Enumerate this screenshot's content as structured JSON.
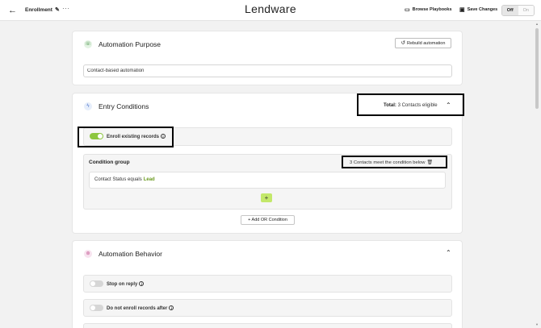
{
  "topbar": {
    "back_icon": "←",
    "workflow_name": "Enrollment",
    "edit_icon": "✎",
    "more_icon": "···",
    "brand": "Lendware",
    "browse_icon": "▭",
    "browse_label": "Browse Playbooks",
    "save_icon": "▣",
    "save_label": "Save Changes",
    "toggle_off": "Off",
    "toggle_on": "On"
  },
  "purpose": {
    "icon": "☏",
    "title": "Automation Purpose",
    "rebuild_icon": "↺",
    "rebuild_label": "Rebuild automation",
    "input_value": "Contact-based automation"
  },
  "entry": {
    "icon": "ϟ",
    "title": "Entry Conditions",
    "total_label": "Total:",
    "total_value": "3 Contacts eligible",
    "chevron_icon": "⌃",
    "enroll_label": "Enroll existing records",
    "info_icon": "i",
    "condition_group": {
      "title": "Condition group",
      "count": "3 Contacts meet the condition below",
      "delete_icon": "🗑",
      "condition_text": "Contact Status equals",
      "condition_value": "Lead",
      "add_icon": "+"
    },
    "add_or_label": "+ Add OR Condition"
  },
  "behavior": {
    "icon": "⊛",
    "title": "Automation Behavior",
    "chevron_icon": "⌃",
    "stop_label": "Stop on reply",
    "no_enroll_label": "Do not enroll records after",
    "info_icon": "i"
  },
  "colors": {
    "toggle_on": "#8dc63f",
    "add_button": "#c3e86a",
    "condition_value": "#6a9a1f"
  }
}
